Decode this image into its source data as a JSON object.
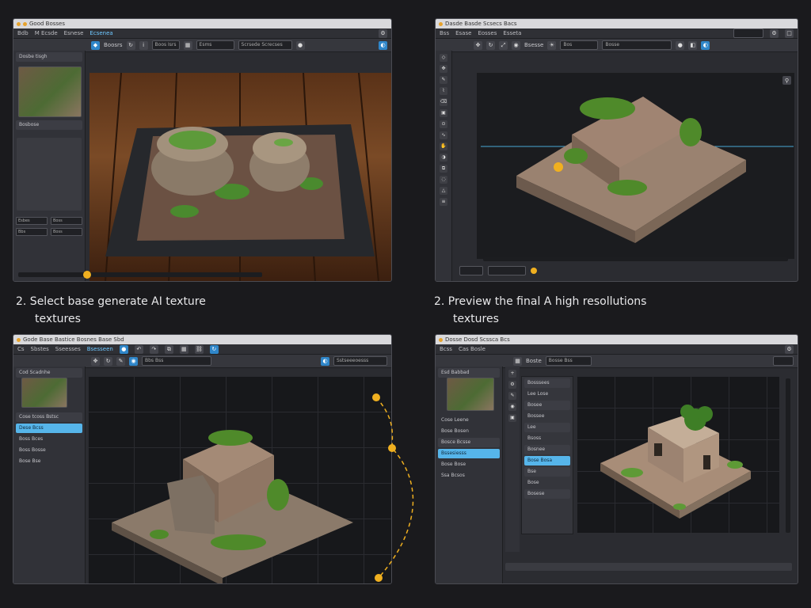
{
  "captions": {
    "top_left_line1": "2. Select base generate AI texture",
    "top_left_line2": "textures",
    "top_right_line1": "2. Preview the final A high resollutions",
    "top_right_line2": "textures"
  },
  "panel_tl": {
    "title": "Good Bosses",
    "menu": [
      "Bdb",
      "M Ecsde",
      "Esnese",
      "Ecsenea"
    ],
    "toolbar_items": [
      "Boosrs",
      "Boos Isrs",
      "Esms"
    ],
    "toolbar_field": "Scrsede Screcses",
    "sidebar_header": "Dosbe tisgh",
    "sidebar_field": "Bosbose",
    "sidebar_rows": [
      "Esbes",
      "Boss",
      "Bbs",
      "Boss"
    ]
  },
  "panel_tr": {
    "title": "Dasde Basde Scsecs Bacs",
    "menu": [
      "Bss",
      "Esase",
      "Eosses",
      "Esseta"
    ],
    "toolbar_items": [
      "Bsesse",
      "Bos",
      "Bosse"
    ]
  },
  "panel_bl": {
    "title": "Gode Base Bastice Bosnes Base Sbd",
    "menu": [
      "Cs",
      "Sbstes",
      "Sseesses",
      "Bsesseen"
    ],
    "toolbar_field": "Bbs Bss",
    "toolbar_right": "Sstseeeoesss",
    "sidebar_header": "Cod Scadnhe",
    "sidebar_items": [
      "Cose tcoss Bstsc",
      "Dese Bcss",
      "Boss Bces",
      "Boss Bosse",
      "Bose Bse"
    ]
  },
  "panel_br": {
    "title": "Dosse Dosd Scssca Bcs",
    "menu": [
      "Bcss",
      "Cas Bosle"
    ],
    "toolbar_items": [
      "Boste",
      "Bosse Bss"
    ],
    "sidebar_header": "Esd Babbad",
    "sidebar_items": [
      "Cose Leene",
      "Bose Bosen",
      "Bosce Bcsse",
      "Bssesiesss",
      "Bose Bose",
      "Ssa Bcsos"
    ],
    "props_items": [
      "Bosssees",
      "Lee Lose",
      "Bosee",
      "Bossee",
      "Lee",
      "Bsoss",
      "Bosnee",
      "Bose Bosa",
      "Bse",
      "Bose",
      "Bosese"
    ]
  },
  "colors": {
    "accent_blue": "#2f86c9",
    "selection": "#56b5ea",
    "handle_yellow": "#f0b020"
  }
}
